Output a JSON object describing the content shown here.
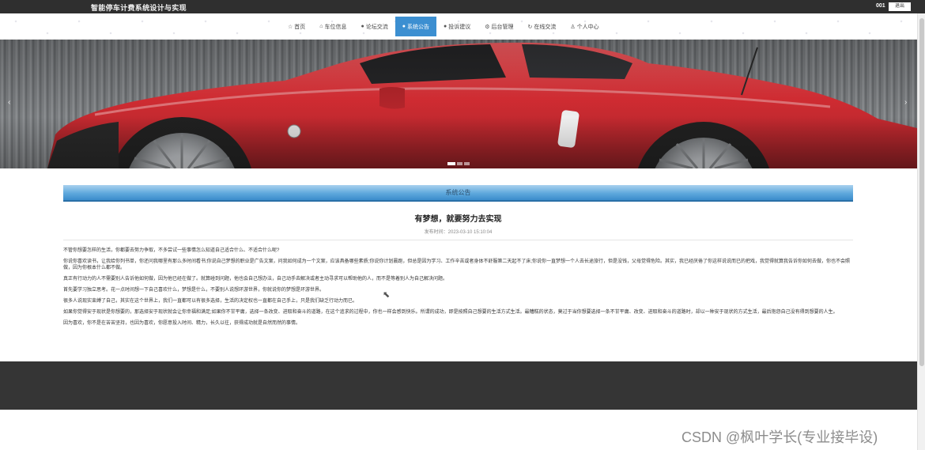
{
  "header": {
    "site_title": "智能停车计费系统设计与实现",
    "user_name": "001",
    "logout_label": "退出"
  },
  "nav": {
    "items": [
      {
        "label": "首页",
        "icon": "☆"
      },
      {
        "label": "车位信息",
        "icon": "⌂"
      },
      {
        "label": "论坛交流",
        "icon": "●"
      },
      {
        "label": "系统公告",
        "icon": "●"
      },
      {
        "label": "投诉建议",
        "icon": "●"
      },
      {
        "label": "后台管理",
        "icon": "⚙"
      },
      {
        "label": "在线交流",
        "icon": "↻"
      },
      {
        "label": "个人中心",
        "icon": "♙"
      }
    ],
    "active_index": 3
  },
  "banner": {
    "prev_icon": "‹",
    "next_icon": "›",
    "slide_count": 3,
    "active_slide": 0
  },
  "section": {
    "title": "系统公告"
  },
  "article": {
    "title": "有梦想，就要努力去实现",
    "time": "发布时间：2023-03-10 15:10:04",
    "paragraphs": [
      "不管你想要怎样的生活，你都要去努力争取，不多尝试一些事情怎么知道自己适合什么、不适合什么呢?",
      "你说你喜欢读书，让我给你列书单，你还问我哪里有那么多时间看书;你说自己梦想的职业是广告文案，问我如何成为一个文案，应该具备哪些素质;你说你计划晨跑，但总是因为学习、工作辛苦或者身体不舒服第二天起不了床;你说你一直梦想一个人去长途旅行，但是没钱，父母觉得危险。其实，我已经厌倦了你这样说说而已的把戏，我觉得就算我告诉你如何去做，你也不会照做，因为你根本什么都不做。",
      "真正有行动力的人不需要别人告诉他如何做，因为他已经在做了。就算碰到问题，他也会自己想办法，自己动手去解决或者主动寻求可以帮助他的人，而不是等着别人为自己解决问题。",
      "首先要学习独立思考。花一点时间想一下自己喜欢什么，梦想是什么，不要别人说想环游世界，你就说你的梦想是环游世界。",
      "很多人说现实束缚了自己，其实在这个世界上，我们一直都可以有很多选择，生活的决定权也一直都在自己手上，只是我们缺乏行动力而已。",
      "如果你觉得安于现状是你想要的，那选择安于现状就会让你幸福和满足;如果你不甘平庸，选择一条改变、进取和奋斗的道路，在这个追求的过程中，你也一样会感到快乐。所谓的成功，即是按照自己想要的生活方式生活。最糟糕的状态，莫过于当你想要选择一条不甘平庸、改变、进取和奋斗的道路时，却以一种安于现状的方式生活，最后抱怨自己没有得到想要的人生。",
      "因为喜欢，你不是在苦苦坚持，也因为喜欢，你愿意投入时间、精力，长久以往，获得成功就是自然而然的事情。"
    ]
  },
  "watermark": "CSDN @枫叶学长(专业接毕设)",
  "colors": {
    "topbar": "#2f2f2f",
    "nav_active": "#3c8fd1",
    "section_header": "#5ea8dc",
    "footer": "#353535",
    "car_red": "#d8232a"
  }
}
